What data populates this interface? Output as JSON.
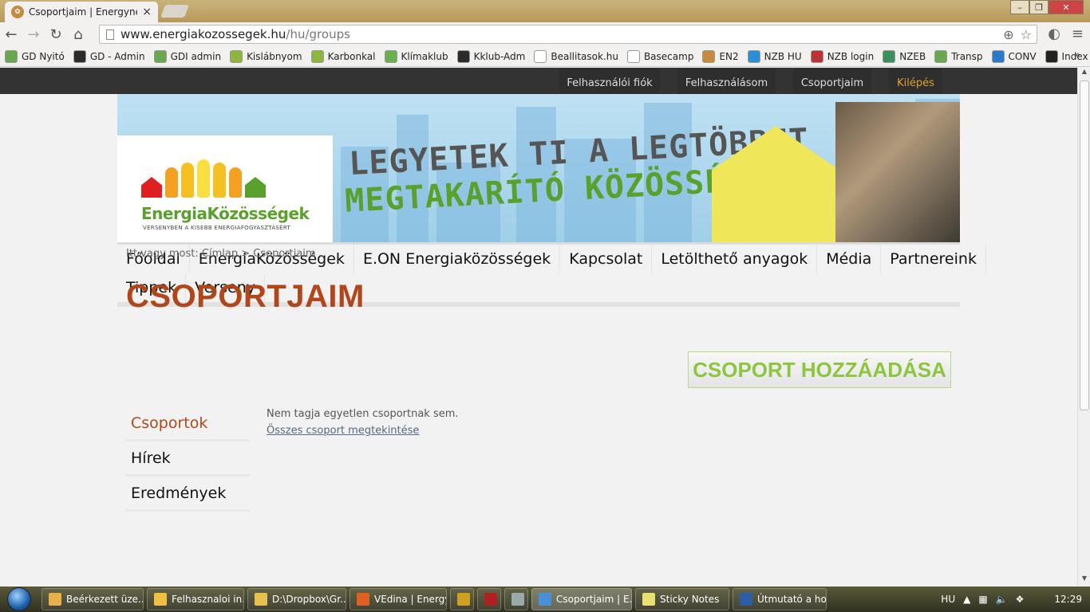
{
  "browser": {
    "tab_title": "Csoportjaim | Energyneig",
    "tab_close": "×",
    "url_host": "www.energiakozossegek.hu",
    "url_path": "/hu/groups",
    "bookmarks": [
      {
        "label": "GD Nyitó",
        "color": "#6aa84f"
      },
      {
        "label": "GD - Admin",
        "color": "#2b2b2b"
      },
      {
        "label": "GDI admin",
        "color": "#6aa84f"
      },
      {
        "label": "Kislábnyom",
        "color": "#8cb63c"
      },
      {
        "label": "Karbonkal",
        "color": "#8cb63c"
      },
      {
        "label": "Klímaklub",
        "color": "#6ab04c"
      },
      {
        "label": "Kklub-Adm",
        "color": "#2b2b2b"
      },
      {
        "label": "Beallitasok.hu",
        "color": "#ffffff"
      },
      {
        "label": "Basecamp",
        "color": "#ffffff"
      },
      {
        "label": "EN2",
        "color": "#c58a3b"
      },
      {
        "label": "NZB HU",
        "color": "#2a8fd6"
      },
      {
        "label": "NZB login",
        "color": "#b33"
      },
      {
        "label": "NZEB",
        "color": "#3a8f5a"
      },
      {
        "label": "Transp",
        "color": "#6aa84f"
      },
      {
        "label": "CONV",
        "color": "#2a7ac9"
      },
      {
        "label": "Index",
        "color": "#222"
      }
    ],
    "bookmarks_more": "»"
  },
  "topbar": {
    "account": "Felhasználói fiók",
    "user": "Felhasználásom",
    "groups": "Csoportjaim",
    "logout": "Kilépés"
  },
  "banner": {
    "logo_name_a": "Energia",
    "logo_name_b": "Közösségek",
    "logo_tag": "VERSENYBEN A KISEBB ENERGIAFOGYASZTÁSÉRT",
    "slogan1": "LEGYETEK TI A LEGTÖBBET",
    "slogan2": "MEGTAKARÍTÓ KÖZÖSSÉG!"
  },
  "mainnav": {
    "row1": [
      "Főoldal",
      "EnergiaKözösségek",
      "E.ON Energiaközösségek",
      "Kapcsolat",
      "Letölthető anyagok",
      "Média",
      "Partnereink"
    ],
    "row2": [
      "Tippek",
      "Verseny"
    ]
  },
  "breadcrumb": {
    "prefix": "Itt vagy most:",
    "home": "Címlap",
    "sep": ">",
    "current": "Csoportjaim"
  },
  "page": {
    "title": "CSOPORTJAIM",
    "add_button": "CSOPORT HOZZÁADÁSA",
    "message": "Nem tagja egyetlen csoportnak sem.",
    "all_groups_link": "Összes csoport megtekintése"
  },
  "sidemenu": [
    "Csoportok",
    "Hírek",
    "Eredmények"
  ],
  "taskbar": {
    "items": [
      {
        "label": "Beérkezett üze...",
        "color": "#e8b04a"
      },
      {
        "label": "Felhasznaloi in...",
        "color": "#f0c040"
      },
      {
        "label": "D:\\Dropbox\\Gr...",
        "color": "#e8c050"
      },
      {
        "label": "VEdina | Energy...",
        "color": "#e06020"
      },
      {
        "label": "",
        "color": "#d0a020"
      },
      {
        "label": "",
        "color": "#b02020"
      },
      {
        "label": "",
        "color": "#9aa"
      },
      {
        "label": "Csoportjaim | E...",
        "color": "#4a90d9"
      },
      {
        "label": "Sticky Notes",
        "color": "#e8e070"
      },
      {
        "label": "Útmutató a ho...",
        "color": "#2a5fa8"
      }
    ],
    "lang": "HU",
    "clock": "12:29"
  }
}
